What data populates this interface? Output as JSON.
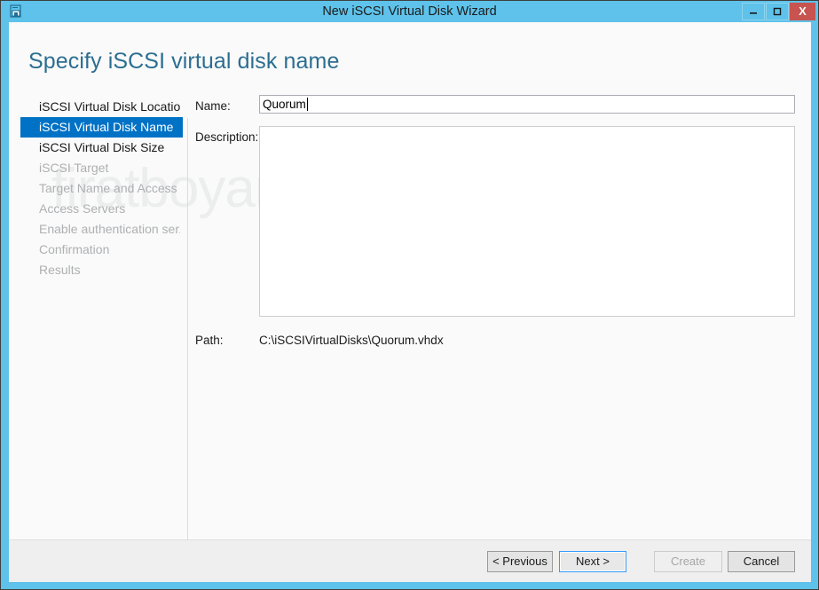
{
  "window": {
    "title": "New iSCSI Virtual Disk Wizard",
    "icon": "iscsi-disk-icon",
    "controls": {
      "minimize": "minimize-icon",
      "maximize": "maximize-icon",
      "close": "X"
    },
    "frame_color": "#5ec2ea",
    "close_color": "#c75450"
  },
  "header": {
    "page_title": "Specify iSCSI virtual disk name",
    "title_color": "#2c6e91"
  },
  "watermark": {
    "text": "firatboyan.com",
    "color": "#eceded"
  },
  "sidebar": {
    "selected_index": 1,
    "selected_color": "#0072c6",
    "items": [
      {
        "label": "iSCSI Virtual Disk Location",
        "state": "enabled"
      },
      {
        "label": "iSCSI Virtual Disk Name",
        "state": "selected"
      },
      {
        "label": "iSCSI Virtual Disk Size",
        "state": "enabled"
      },
      {
        "label": "iSCSI Target",
        "state": "disabled"
      },
      {
        "label": "Target Name and Access",
        "state": "disabled"
      },
      {
        "label": "Access Servers",
        "state": "disabled"
      },
      {
        "label": "Enable authentication ser...",
        "state": "disabled"
      },
      {
        "label": "Confirmation",
        "state": "disabled"
      },
      {
        "label": "Results",
        "state": "disabled"
      }
    ]
  },
  "form": {
    "name": {
      "label": "Name:",
      "value": "Quorum",
      "placeholder": ""
    },
    "description": {
      "label": "Description:",
      "value": "",
      "placeholder": ""
    },
    "path": {
      "label": "Path:",
      "value": "C:\\iSCSIVirtualDisks\\Quorum.vhdx"
    }
  },
  "footer": {
    "buttons": [
      {
        "label": "< Previous",
        "state": "enabled"
      },
      {
        "label": "Next >",
        "state": "focused"
      },
      {
        "label": "Create",
        "state": "disabled"
      },
      {
        "label": "Cancel",
        "state": "enabled"
      }
    ]
  }
}
